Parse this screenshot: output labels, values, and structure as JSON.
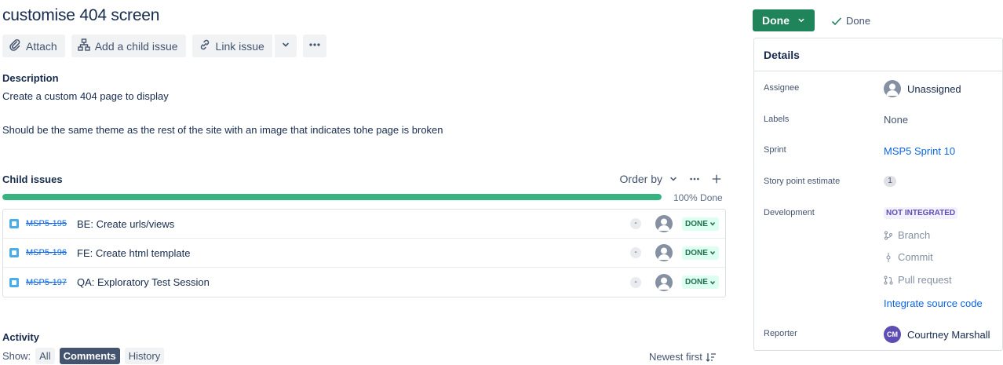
{
  "issue": {
    "title": "customise 404 screen"
  },
  "toolbar": {
    "attach": "Attach",
    "add_child": "Add a child issue",
    "link_issue": "Link issue"
  },
  "description": {
    "label": "Description",
    "line1": "Create a custom 404 page to display",
    "line2": "Should be the same theme as the rest of the site with an image that indicates tohe page is broken"
  },
  "child_issues": {
    "label": "Child issues",
    "order_by": "Order by",
    "progress_percent": 100,
    "progress_label": "100% Done",
    "items": [
      {
        "key": "MSP5-195",
        "summary": "BE: Create urls/views",
        "priority": "-",
        "status": "DONE"
      },
      {
        "key": "MSP5-196",
        "summary": "FE: Create html template",
        "priority": "-",
        "status": "DONE"
      },
      {
        "key": "MSP5-197",
        "summary": "QA: Exploratory Test Session",
        "priority": "-",
        "status": "DONE"
      }
    ]
  },
  "activity": {
    "label": "Activity",
    "show_label": "Show:",
    "filters": [
      "All",
      "Comments",
      "History"
    ],
    "active_filter": "Comments",
    "sort": "Newest first"
  },
  "status": {
    "button": "Done",
    "resolution": "Done"
  },
  "details": {
    "header": "Details",
    "assignee_label": "Assignee",
    "assignee": "Unassigned",
    "labels_label": "Labels",
    "labels": "None",
    "sprint_label": "Sprint",
    "sprint": "MSP5 Sprint 10",
    "story_points_label": "Story point estimate",
    "story_points": "1",
    "development_label": "Development",
    "development_status": "NOT INTEGRATED",
    "branch": "Branch",
    "commit": "Commit",
    "pull_request": "Pull request",
    "integrate": "Integrate source code",
    "reporter_label": "Reporter",
    "reporter_initials": "CM",
    "reporter": "Courtney Marshall"
  },
  "colors": {
    "status_green": "#1f845a",
    "progress_green": "#36b37e",
    "link_blue": "#0c66e4",
    "reporter_avatar": "#5e4db2"
  }
}
